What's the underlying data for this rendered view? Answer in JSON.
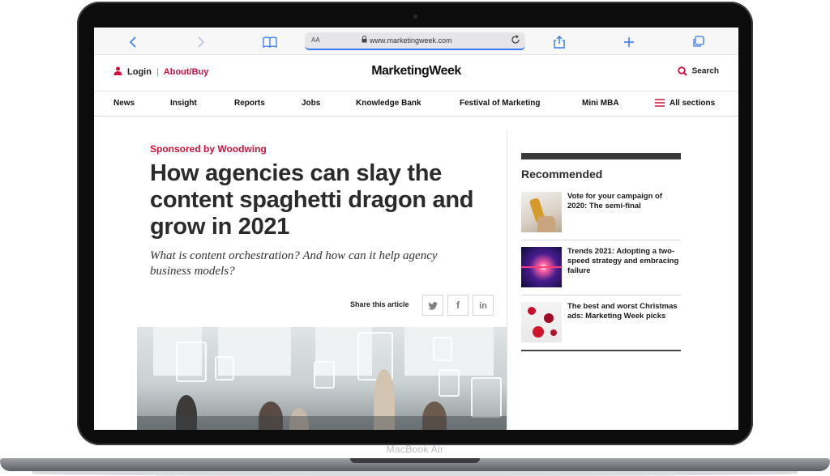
{
  "device": {
    "label": "MacBook Air"
  },
  "browser": {
    "text_size_label": "AA",
    "url": "www.marketingweek.com",
    "icons": [
      "back-icon",
      "forward-icon",
      "book-icon",
      "lock-icon",
      "reload-icon",
      "share-icon",
      "plus-icon",
      "tabs-icon"
    ],
    "accent": "#3478f6"
  },
  "header": {
    "login_label": "Login",
    "separator": "|",
    "about_label": "About/Buy",
    "logo": "MarketingWeek",
    "search_label": "Search",
    "accent": "#d1103d"
  },
  "nav": {
    "items": [
      "News",
      "Insight",
      "Reports",
      "Jobs",
      "Knowledge Bank",
      "Festival of Marketing",
      "Mini MBA"
    ],
    "all_sections_label": "All sections"
  },
  "article": {
    "sponsor": "Sponsored by Woodwing",
    "headline": "How agencies can slay the content spaghetti dragon and grow in 2021",
    "standfirst": "What is content orchestration? And how can it help agency business models?",
    "share_label": "Share this article",
    "share_buttons": [
      "twitter-icon",
      "facebook-icon",
      "linkedin-icon"
    ]
  },
  "recommended": {
    "title": "Recommended",
    "items": [
      {
        "title": "Vote for your campaign of 2020: The semi-final"
      },
      {
        "title": "Trends 2021: Adopting a two-speed strategy and embracing failure"
      },
      {
        "title": "The best and worst Christmas ads: Marketing Week picks"
      }
    ]
  }
}
